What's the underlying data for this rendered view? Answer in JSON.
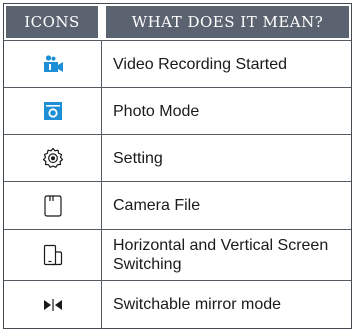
{
  "table": {
    "header_icons": "ICONS",
    "header_meaning": "WHAT DOES IT MEAN?",
    "rows": [
      {
        "icon": "video-camera-icon",
        "meaning": "Video Recording Started"
      },
      {
        "icon": "photo-camera-icon",
        "meaning": "Photo Mode"
      },
      {
        "icon": "gear-icon",
        "meaning": "Setting"
      },
      {
        "icon": "sd-card-icon",
        "meaning": "Camera File"
      },
      {
        "icon": "screen-rotate-icon",
        "meaning": "Horizontal and Vertical Screen Switching"
      },
      {
        "icon": "mirror-icon",
        "meaning": "Switchable mirror mode"
      }
    ]
  },
  "colors": {
    "header_bg": "#5b6270",
    "icon_blue": "#1e8fd6",
    "border": "#444a52"
  }
}
